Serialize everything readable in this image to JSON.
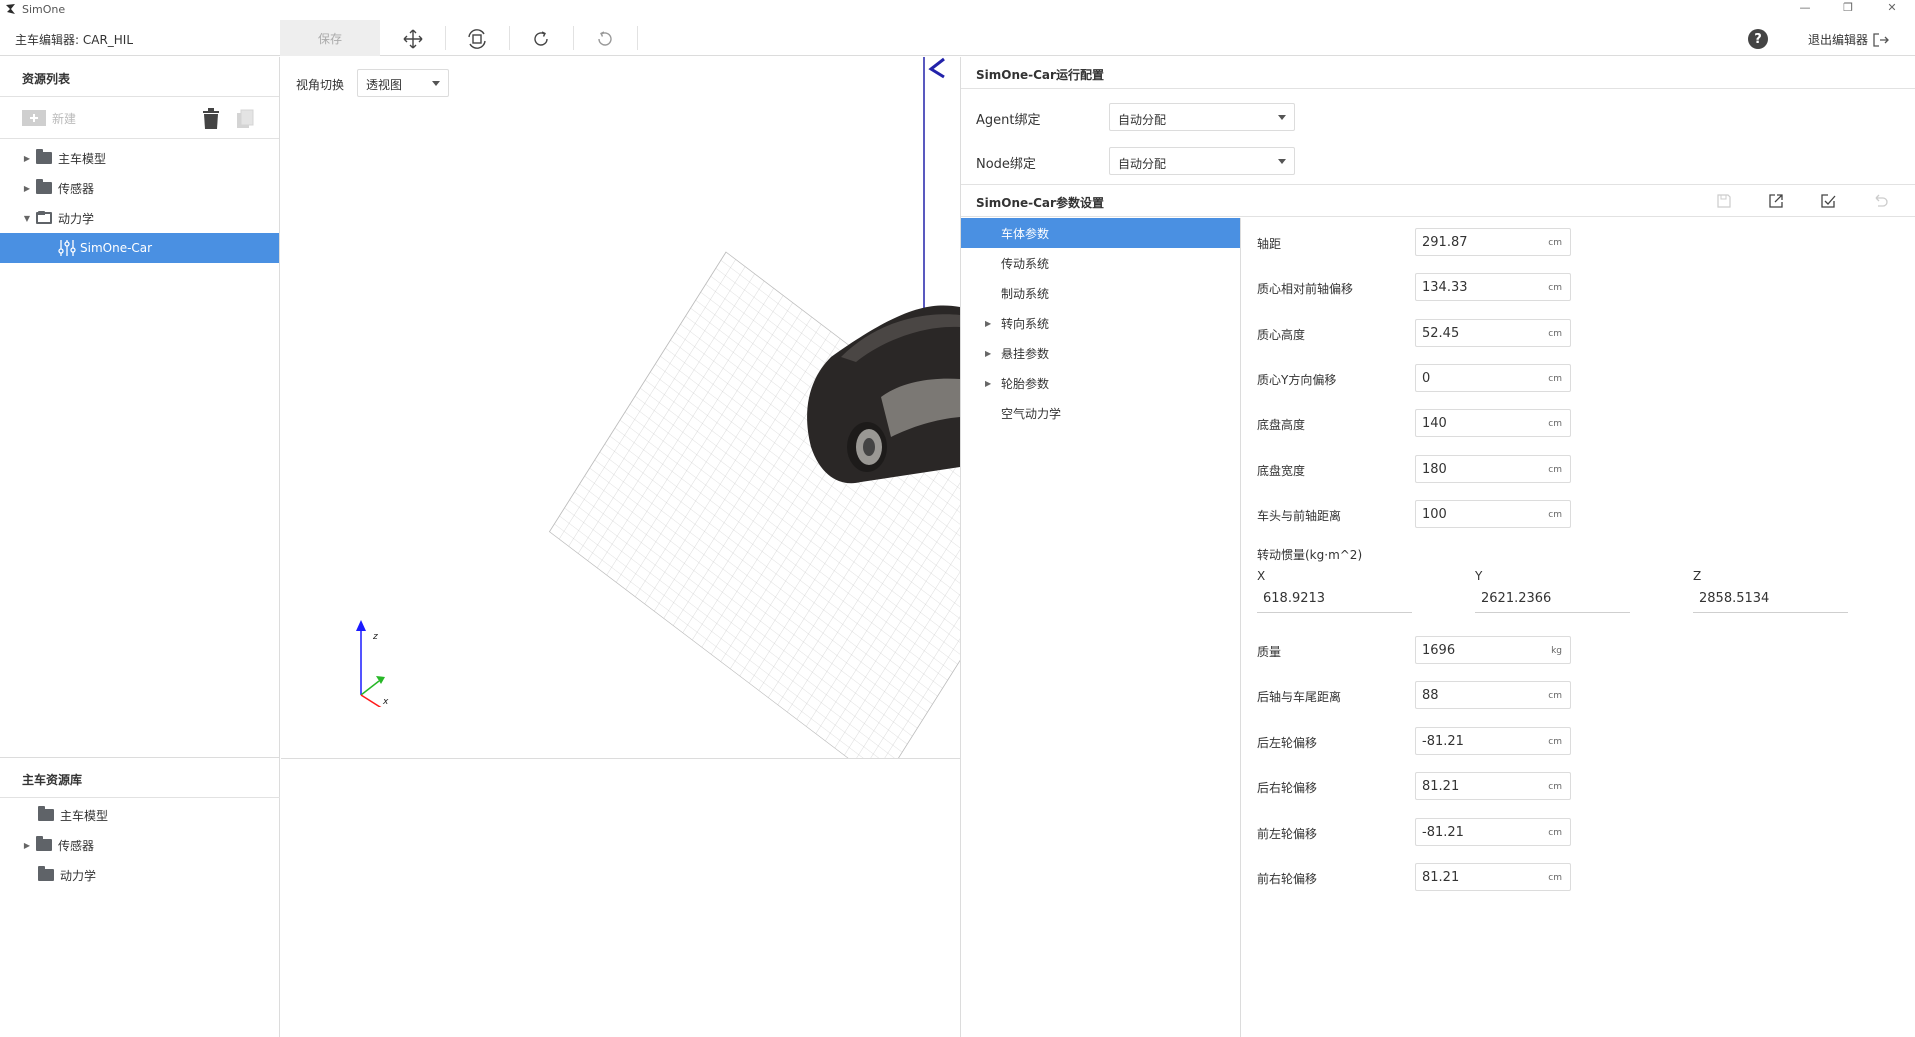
{
  "app": {
    "title": "SimOne"
  },
  "toolbar": {
    "editor_title": "主车编辑器: CAR_HIL",
    "save_label": "保存",
    "help_label": "?",
    "exit_label": "退出编辑器"
  },
  "left": {
    "resources_title": "资源列表",
    "new_label": "新建",
    "tree": [
      {
        "label": "主车模型"
      },
      {
        "label": "传感器"
      },
      {
        "label": "动力学"
      },
      {
        "label": "SimOne-Car"
      }
    ],
    "library_title": "主车资源库",
    "library": [
      {
        "label": "主车模型"
      },
      {
        "label": "传感器"
      },
      {
        "label": "动力学"
      }
    ]
  },
  "viewport": {
    "view_label": "视角切换",
    "view_value": "透视图",
    "axes": {
      "z": "z",
      "x": "x"
    }
  },
  "run_config": {
    "title": "SimOne-Car运行配置",
    "agent_label": "Agent绑定",
    "agent_value": "自动分配",
    "node_label": "Node绑定",
    "node_value": "自动分配"
  },
  "param_settings": {
    "title": "SimOne-Car参数设置",
    "categories": [
      {
        "label": "车体参数"
      },
      {
        "label": "传动系统"
      },
      {
        "label": "制动系统"
      },
      {
        "label": "转向系统"
      },
      {
        "label": "悬挂参数"
      },
      {
        "label": "轮胎参数"
      },
      {
        "label": "空气动力学"
      }
    ],
    "params_top": [
      {
        "label": "轴距",
        "value": "291.87",
        "unit": "cm"
      },
      {
        "label": "质心相对前轴偏移",
        "value": "134.33",
        "unit": "cm"
      },
      {
        "label": "质心高度",
        "value": "52.45",
        "unit": "cm"
      },
      {
        "label": "质心Y方向偏移",
        "value": "0",
        "unit": "cm"
      },
      {
        "label": "底盘高度",
        "value": "140",
        "unit": "cm"
      },
      {
        "label": "底盘宽度",
        "value": "180",
        "unit": "cm"
      },
      {
        "label": "车头与前轴距离",
        "value": "100",
        "unit": "cm"
      }
    ],
    "inertia": {
      "label": "转动惯量(kg·m^2)",
      "x_label": "X",
      "x_value": "618.9213",
      "y_label": "Y",
      "y_value": "2621.2366",
      "z_label": "Z",
      "z_value": "2858.5134"
    },
    "params_bottom": [
      {
        "label": "质量",
        "value": "1696",
        "unit": "kg"
      },
      {
        "label": "后轴与车尾距离",
        "value": "88",
        "unit": "cm"
      },
      {
        "label": "后左轮偏移",
        "value": "-81.21",
        "unit": "cm"
      },
      {
        "label": "后右轮偏移",
        "value": "81.21",
        "unit": "cm"
      },
      {
        "label": "前左轮偏移",
        "value": "-81.21",
        "unit": "cm"
      },
      {
        "label": "前右轮偏移",
        "value": "81.21",
        "unit": "cm"
      }
    ]
  }
}
